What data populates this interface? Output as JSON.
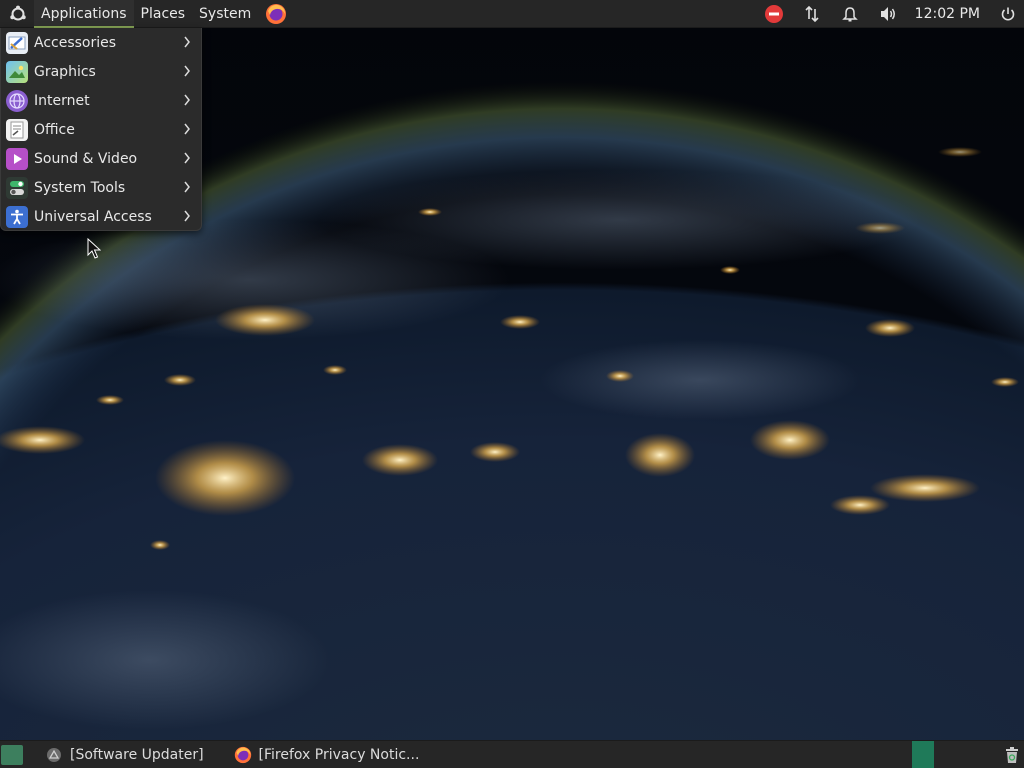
{
  "top_panel": {
    "menus": [
      "Applications",
      "Places",
      "System"
    ],
    "clock": "12:02 PM",
    "icons": {
      "logo": "ubuntu-logo-icon",
      "launcher": "firefox-icon",
      "tray": [
        "do-not-disturb-icon",
        "network-icon",
        "bell-icon",
        "volume-icon",
        "power-icon"
      ]
    }
  },
  "app_menu": {
    "items": [
      {
        "label": "Accessories",
        "icon": "accessories-icon"
      },
      {
        "label": "Graphics",
        "icon": "graphics-icon"
      },
      {
        "label": "Internet",
        "icon": "internet-icon"
      },
      {
        "label": "Office",
        "icon": "office-icon"
      },
      {
        "label": "Sound & Video",
        "icon": "sound-video-icon"
      },
      {
        "label": "System Tools",
        "icon": "system-tools-icon"
      },
      {
        "label": "Universal Access",
        "icon": "universal-access-icon"
      }
    ]
  },
  "taskbar": {
    "tasks": [
      {
        "label": "[Software Updater]",
        "icon": "software-updater-icon"
      },
      {
        "label": "[Firefox Privacy Notic...",
        "icon": "firefox-icon"
      }
    ]
  },
  "colors": {
    "panel": "#262626",
    "menu_bg": "#2b2b2b",
    "accent": "#87a556",
    "workspace": "#1f7a59"
  }
}
